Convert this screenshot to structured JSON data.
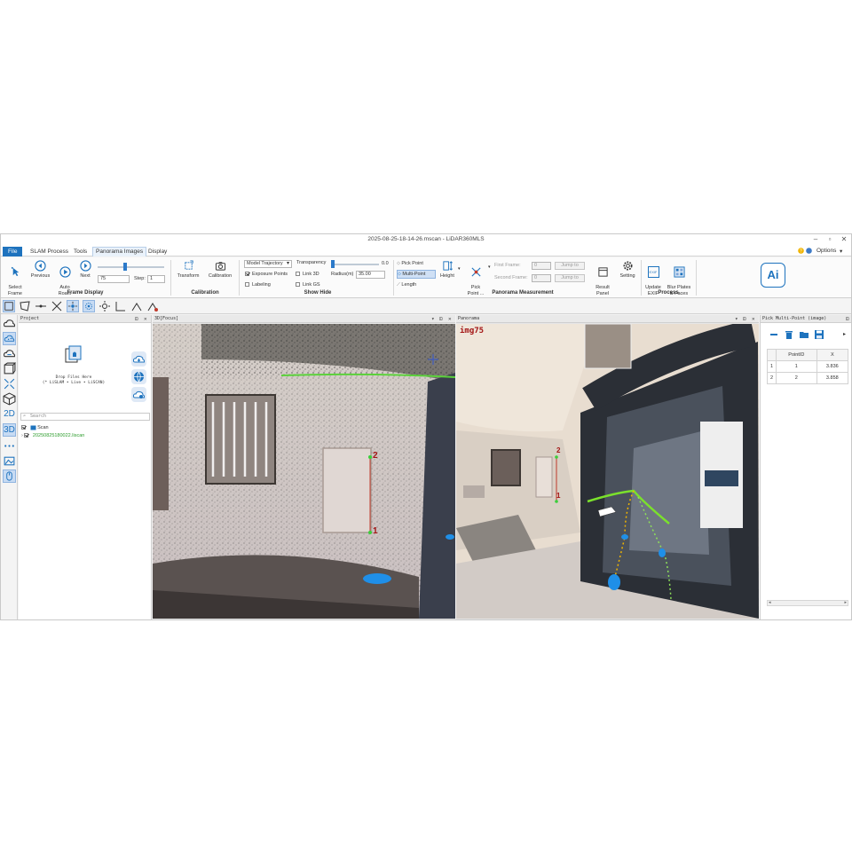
{
  "window": {
    "title": "2025-08-25-18-14-26.mscan - LiDAR360MLS",
    "controls": [
      "?",
      "–",
      "▫",
      "✕"
    ]
  },
  "menu": {
    "items": [
      "File",
      "SLAM Process",
      "Tools",
      "Panorama Images",
      "Display"
    ],
    "active": "Panorama Images",
    "options_label": "Options"
  },
  "ribbon": {
    "frame_display": {
      "label": "Frame Display",
      "select_frame": "Select\nFrame",
      "previous": "Previous",
      "auto_roam": "Auto\nRoam",
      "next": "Next",
      "frame_value": "75",
      "step_label": "Step:",
      "step_value": "1"
    },
    "calibration": {
      "label": "Calibration",
      "transform": "Transform",
      "calibration": "Calibration"
    },
    "show_hide": {
      "label": "Show Hide",
      "dropdown_value": "Model Trajectory",
      "transparency_label": "Transparency",
      "transparency_value": "0.0",
      "exposure_points": "Exposure Points",
      "link_3d": "Link 3D",
      "labeling": "Labeling",
      "link_gs": "Link GS",
      "radius_label": "Radius(m)",
      "radius_value": "35.00"
    },
    "panorama_measurement": {
      "label": "Panorama Measurement",
      "pick_point": "Pick Point",
      "multi_point": "Multi-Point",
      "length": "Length",
      "height": "Height",
      "pick_point_more": "Pick\nPoint ...",
      "first_frame": "First Frame:",
      "first_frame_value": "0",
      "second_frame": "Second Frame:",
      "second_frame_value": "0",
      "jump_to": "Jump to",
      "result_panel": "Result\nPanel",
      "setting": "Setting"
    },
    "process": {
      "label": "Process",
      "update_exif": "Update\nEXIF",
      "blur_plates": "Blur Plates\n& Faces",
      "exif_badge": "EXIF"
    },
    "ai_label": "Ai"
  },
  "project_panel": {
    "title": "Project",
    "drop_text_1": "Drop Files Here",
    "drop_text_2": "(* LiSLAM • Live • LiSCAN)",
    "search_placeholder": "Search",
    "tree": {
      "root": "Scan",
      "file": "20250825180022.liscan"
    }
  },
  "view3d": {
    "title": "3D[Focus]",
    "labels": [
      "2",
      "1"
    ]
  },
  "panorama": {
    "title": "Panorama",
    "image_label": "img75",
    "labels": [
      "2",
      "1"
    ]
  },
  "pick_panel": {
    "title": "Pick Multi-Point (image)",
    "columns": [
      "",
      "PointID",
      "X"
    ],
    "rows": [
      [
        "1",
        "1",
        "3.836"
      ],
      [
        "2",
        "2",
        "3.858"
      ]
    ]
  },
  "colors": {
    "accent": "#1e73be",
    "highlight": "#c7dbf3",
    "tree_file": "#2e9d2e",
    "marker_red": "#a31515"
  }
}
